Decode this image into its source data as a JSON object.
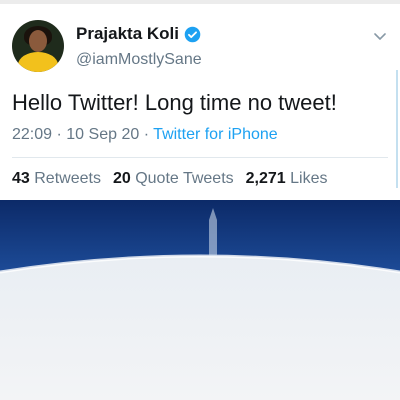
{
  "tweet": {
    "display_name": "Prajakta Koli",
    "handle": "@iamMostlySane",
    "text": "Hello Twitter! Long time no tweet!",
    "time": "22:09",
    "separator": "·",
    "date": "10 Sep 20",
    "source": "Twitter for iPhone",
    "stats": {
      "retweets_count": "43",
      "retweets_label": "Retweets",
      "quotes_count": "20",
      "quotes_label": "Quote Tweets",
      "likes_count": "2,271",
      "likes_label": "Likes"
    }
  },
  "icons": {
    "verified": "verified-badge-icon",
    "more": "chevron-down-icon"
  },
  "colors": {
    "accent": "#1da1f2",
    "secondary_text": "#657786",
    "primary_text": "#14171a",
    "photo_sky": "#0f2f6e",
    "photo_horizon": "#dfe8f0"
  }
}
